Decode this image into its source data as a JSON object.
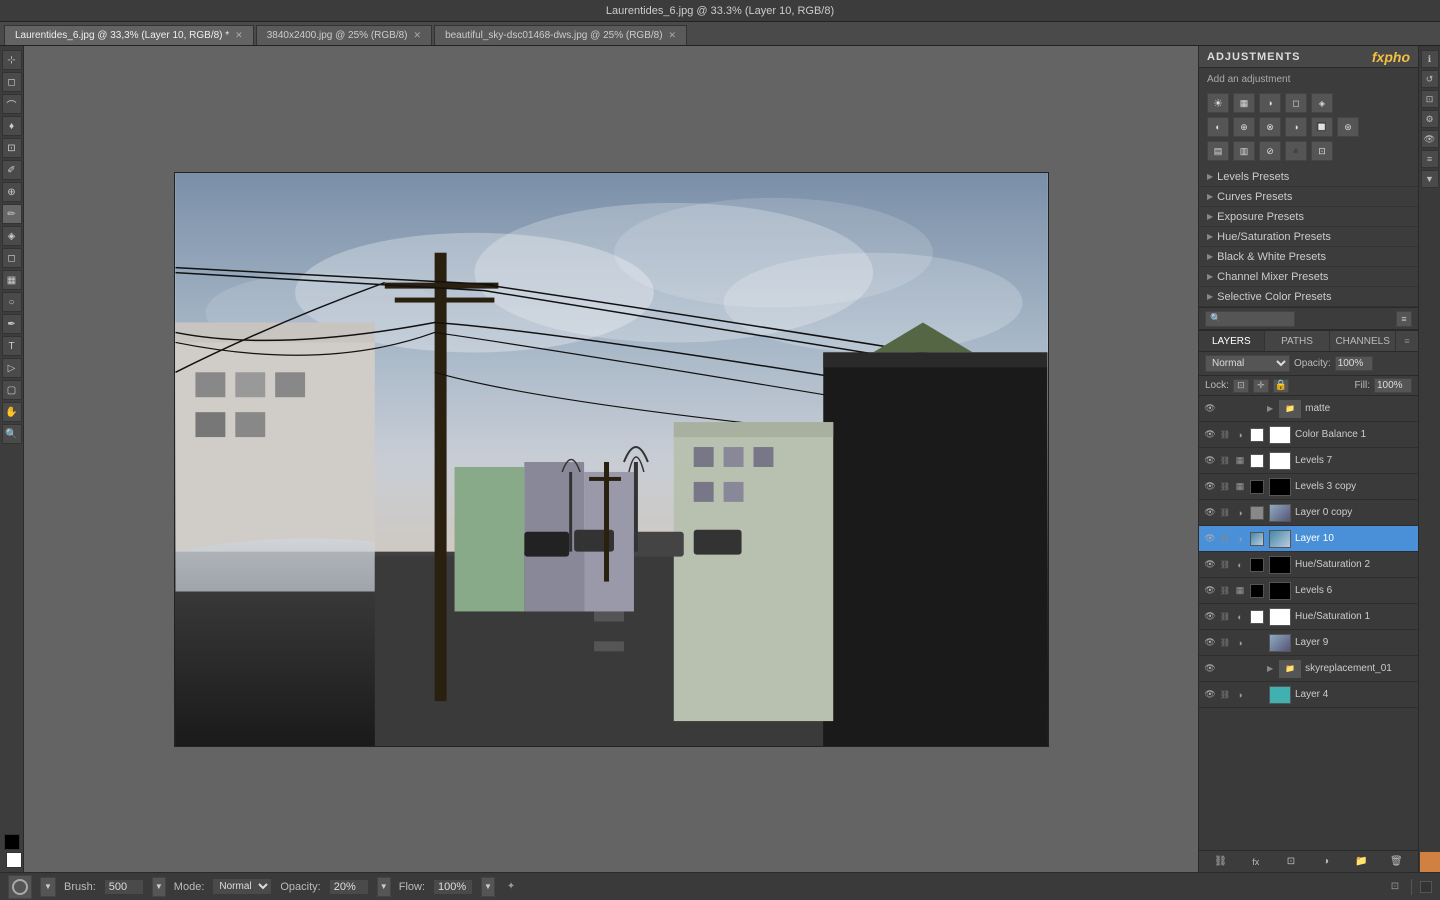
{
  "titlebar": {
    "title": "Laurentides_6.jpg @ 33.3% (Layer 10, RGB/8)"
  },
  "tabs": [
    {
      "id": "tab1",
      "label": "Laurentides_6.jpg @ 33.3% (Layer 10, RGB/8)",
      "active": true,
      "closeable": true
    },
    {
      "id": "tab2",
      "label": "3840x2400.jpg @ 25% (RGB/8)",
      "active": false,
      "closeable": true
    },
    {
      "id": "tab3",
      "label": "beautiful_sky-dsc01468-dws.jpg @ 25% (RGB/8)",
      "active": false,
      "closeable": true
    }
  ],
  "adjustments": {
    "title": "ADJUSTMENTS",
    "fxpho": "fxpho",
    "add_adjustment": "Add an adjustment",
    "icon_rows": [
      [
        "☀",
        "📊",
        "◑",
        "▣",
        "◈"
      ],
      [
        "◐",
        "⊕",
        "⊗",
        "◑",
        "🔲",
        "⊛"
      ],
      [
        "▤",
        "▥",
        "⊘",
        "◾",
        "⊡"
      ]
    ],
    "presets": [
      {
        "label": "Levels Presets"
      },
      {
        "label": "Curves Presets"
      },
      {
        "label": "Exposure Presets"
      },
      {
        "label": "Hue/Saturation Presets"
      },
      {
        "label": "Black & White Presets"
      },
      {
        "label": "Channel Mixer Presets"
      },
      {
        "label": "Selective Color Presets"
      }
    ]
  },
  "layers": {
    "tabs": [
      {
        "label": "LAYERS",
        "active": true
      },
      {
        "label": "PATHS",
        "active": false
      },
      {
        "label": "CHANNELS",
        "active": false
      }
    ],
    "blend_mode": "Normal",
    "opacity": "100%",
    "fill": "100%",
    "lock_label": "Lock:",
    "rows": [
      {
        "id": "matte",
        "name": "matte",
        "type": "group",
        "visible": true,
        "thumb": "none",
        "selected": false
      },
      {
        "id": "color-balance-1",
        "name": "Color Balance 1",
        "type": "adjustment",
        "visible": true,
        "thumb": "white",
        "selected": false
      },
      {
        "id": "levels-7",
        "name": "Levels 7",
        "type": "adjustment",
        "visible": true,
        "thumb": "white",
        "selected": false
      },
      {
        "id": "levels-3-copy",
        "name": "Levels 3 copy",
        "type": "adjustment",
        "visible": true,
        "thumb": "dark",
        "selected": false
      },
      {
        "id": "layer-0-copy",
        "name": "Layer 0 copy",
        "type": "layer",
        "visible": true,
        "thumb": "photo",
        "selected": false
      },
      {
        "id": "layer-10",
        "name": "Layer 10",
        "type": "layer",
        "visible": true,
        "thumb": "sky",
        "selected": true
      },
      {
        "id": "hue-sat-2",
        "name": "Hue/Saturation 2",
        "type": "adjustment",
        "visible": true,
        "thumb": "dark",
        "selected": false
      },
      {
        "id": "levels-6",
        "name": "Levels 6",
        "type": "adjustment",
        "visible": true,
        "thumb": "dark",
        "selected": false
      },
      {
        "id": "hue-sat-1",
        "name": "Hue/Saturation 1",
        "type": "adjustment",
        "visible": true,
        "thumb": "white",
        "selected": false
      },
      {
        "id": "layer-9",
        "name": "Layer 9",
        "type": "layer",
        "visible": true,
        "thumb": "photo",
        "selected": false
      },
      {
        "id": "sky-group",
        "name": "skyreplacement_01",
        "type": "group",
        "visible": true,
        "thumb": "none",
        "selected": false
      },
      {
        "id": "layer-4",
        "name": "Layer 4",
        "type": "layer",
        "visible": true,
        "thumb": "teal",
        "selected": false
      }
    ],
    "toolbar_icons": [
      "🔗",
      "fx",
      "⊡",
      "◐",
      "📁",
      "🗑"
    ]
  },
  "bottom_bar": {
    "brush_label": "Brush:",
    "brush_size": "500",
    "mode_label": "Mode:",
    "mode_value": "Normal",
    "opacity_label": "Opacity:",
    "opacity_value": "20%",
    "flow_label": "Flow:",
    "flow_value": "100%"
  },
  "left_tools": [
    "M",
    "V",
    "L",
    "W",
    "C",
    "S",
    "T",
    "P",
    "B",
    "E",
    "G",
    "H",
    "Z"
  ]
}
